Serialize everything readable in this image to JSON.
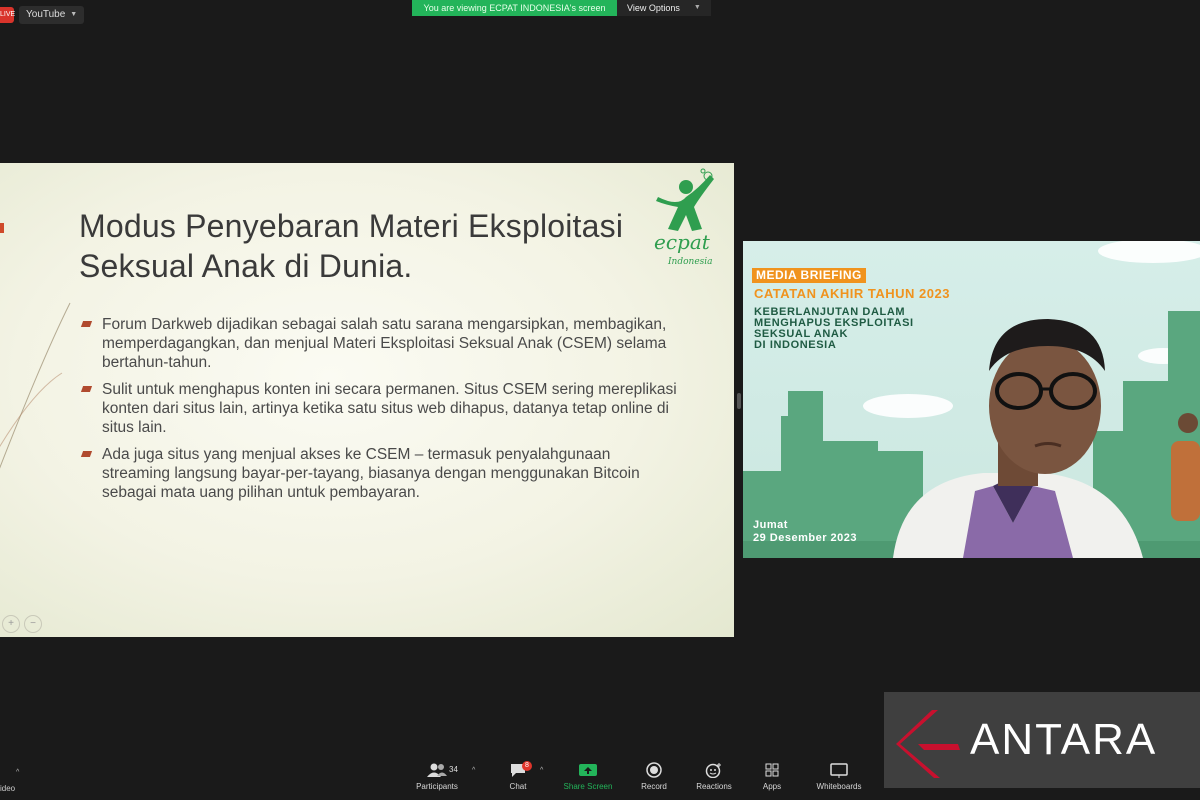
{
  "top_left": {
    "live_label": "LIVE",
    "youtube_label": "YouTube"
  },
  "banner": {
    "viewing_text": "You are viewing ECPAT INDONESIA's screen",
    "view_options_label": "View Options"
  },
  "slide": {
    "title_line1": "Modus Penyebaran Materi Eksploitasi",
    "title_line2": "Seksual Anak di Dunia.",
    "bullets": [
      "Forum Darkweb dijadikan sebagai salah satu sarana mengarsipkan, membagikan, memperdagangkan, dan menjual Materi Eksploitasi Seksual Anak (CSEM) selama bertahun-tahun.",
      "Sulit untuk menghapus konten ini secara permanen. Situs CSEM sering mereplikasi konten dari situs lain, artinya ketika satu situs web dihapus, datanya tetap online di situs lain.",
      "Ada juga situs yang menjual akses ke CSEM – termasuk penyalahgunaan streaming langsung bayar-per-tayang, biasanya dengan menggunakan Bitcoin sebagai mata uang pilihan untuk pembayaran."
    ],
    "logo_text": "ECPAT",
    "logo_subtext": "Indonesia"
  },
  "video": {
    "media_briefing": "MEDIA BRIEFING",
    "catatan": "CATATAN AKHIR TAHUN 2023",
    "topic_lines": [
      "KEBERLANJUTAN DALAM",
      "MENGHAPUS EKSPLOITASI",
      "SEKSUAL ANAK",
      "DI INDONESIA"
    ],
    "day": "Jumat",
    "date": "29 Desember 2023"
  },
  "watermark": {
    "text": "ANTARA",
    "accent_color": "#c8102e"
  },
  "toolbar": {
    "video_label": "ideo",
    "participants_label": "Participants",
    "participants_count": "34",
    "chat_label": "Chat",
    "chat_badge": "8",
    "share_label": "Share Screen",
    "record_label": "Record",
    "reactions_label": "Reactions",
    "apps_label": "Apps",
    "whiteboards_label": "Whiteboards"
  },
  "colors": {
    "share_green": "#23b45a",
    "slide_bullet": "#b04a2e",
    "ecpat_green": "#2f9e4f",
    "video_orange": "#f0931e",
    "building_green": "#5aa77f"
  }
}
